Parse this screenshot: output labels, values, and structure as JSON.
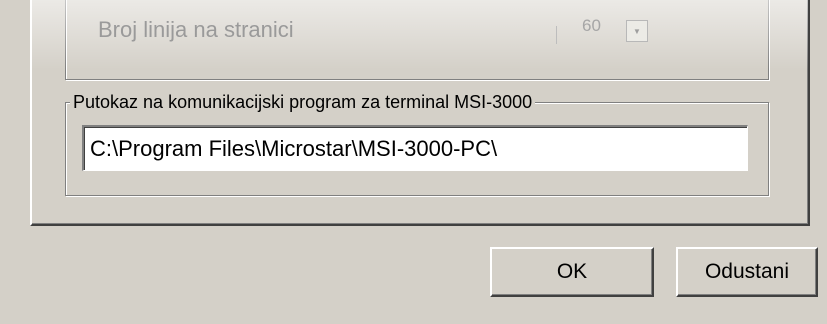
{
  "lines_per_page": {
    "label": "Broj linija na stranici",
    "value": "60",
    "arrow": "▼",
    "icon": "chevron-down-icon"
  },
  "path_group": {
    "legend": "Putokaz na komunikacijski program za terminal MSI-3000",
    "path_value": "C:\\Program Files\\Microstar\\MSI-3000-PC\\"
  },
  "buttons": {
    "ok": "OK",
    "cancel": "Odustani"
  },
  "colors": {
    "face": "#d4d0c8",
    "disabled_text": "#9a9a9a",
    "input_bg": "#ffffff"
  }
}
